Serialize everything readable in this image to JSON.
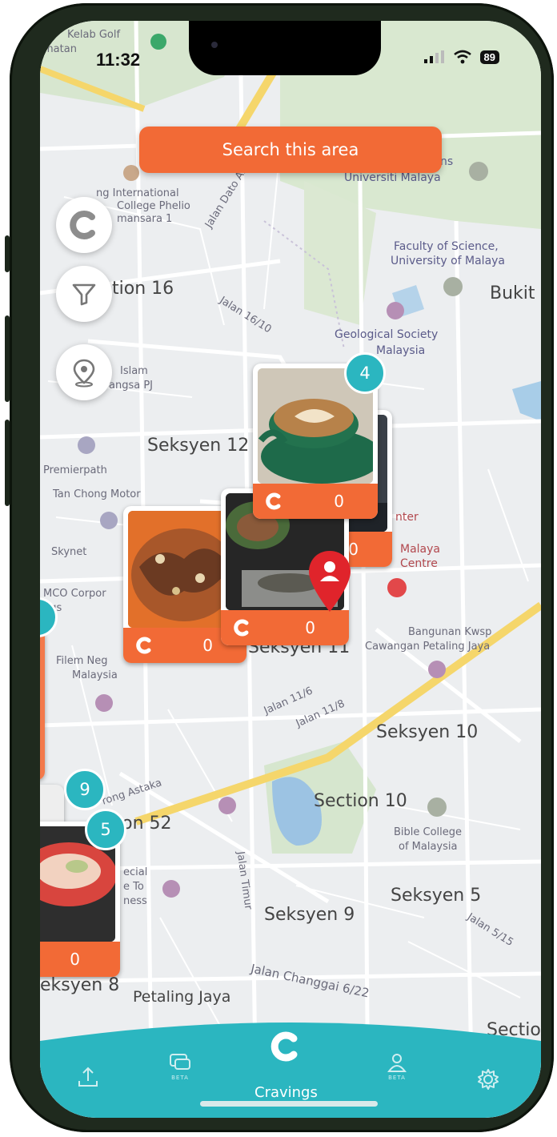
{
  "status_bar": {
    "time": "11:32",
    "battery": "89"
  },
  "search": {
    "label": "Search this area"
  },
  "map_labels": {
    "kelab_golf": "Kelab Golf",
    "amatan": "matan",
    "intl_college": "ng International",
    "college_phelio": "College Phelio",
    "mansara": "mansara 1",
    "universiti": "ns",
    "universiti_malaya": "Universiti Malaya",
    "faculty": "Faculty of Science,",
    "faculty2": "University of Malaya",
    "bukit": "Bukit",
    "section16": "tion 16",
    "jalan_dato": "Jalan Dato Abu Bakar",
    "jalan_16_10": "Jalan 16/10",
    "geological": "Geological Society",
    "geological2": "Malaysia",
    "islam": "Islam",
    "sangsa": "angsa PJ",
    "seksyen12": "Seksyen 12",
    "premierpath": "Premierpath",
    "tan_chong": "Tan Chong Motor",
    "enter": "nter",
    "skynet": "Skynet",
    "malaya_centre": "Malaya",
    "malaya_centre2": "Centre",
    "mco": "MCO Corpor",
    "ngs": "ngs",
    "bangunan": "Bangunan Kwsp",
    "cawangan": "Cawangan Petaling Jaya",
    "seksyen11": "Seksyen 11",
    "filem": "Filem Neg",
    "filem2": "Malaysia",
    "jalan_11_6": "Jalan 11/6",
    "jalan_11_8": "Jalan 11/8",
    "seksyen10": "Seksyen 10",
    "lorong_astaka": "rong Astaka",
    "section10": "Section 10",
    "section52": "ion 52",
    "bible": "Bible College",
    "bible2": "of Malaysia",
    "special": "ecial",
    "to": "e To",
    "ness": "ness",
    "jalan_timur": "Jalan Timur",
    "seksyen5": "Seksyen 5",
    "jalan_5_15": "Jalan 5/15",
    "seksyen9": "Seksyen 9",
    "seksyen8": "eksyen 8",
    "petaling": "Petaling Jaya",
    "changgai": "Jalan Changgai 6/22",
    "sectio": "Sectio"
  },
  "clusters": [
    {
      "count": "4",
      "value": "0"
    },
    {
      "value": "0"
    },
    {
      "value": "0"
    },
    {
      "value": "0"
    },
    {
      "count": "9"
    },
    {
      "count": "5",
      "value": "0"
    }
  ],
  "tab_bar": {
    "active_label": "Cravings",
    "beta": "BETA",
    "colors": {
      "bar": "#2bb6c0",
      "accent": "#f26a36"
    }
  }
}
